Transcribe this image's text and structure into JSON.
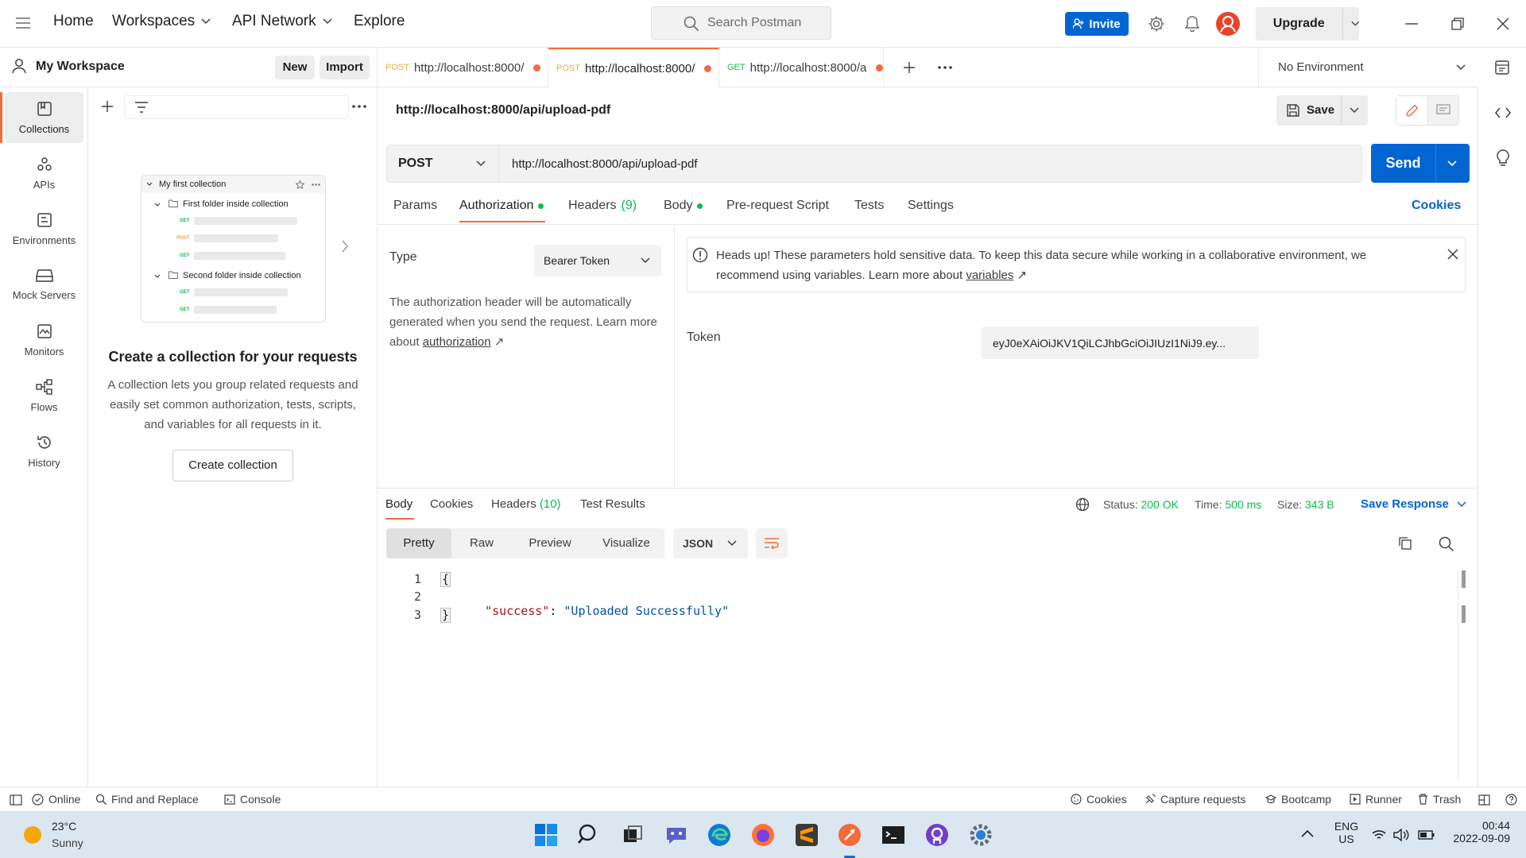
{
  "topbar": {
    "nav": [
      "Home",
      "Workspaces",
      "API Network",
      "Explore"
    ],
    "search_placeholder": "Search Postman",
    "invite_label": "Invite",
    "upgrade_label": "Upgrade"
  },
  "workspace": {
    "title": "My Workspace",
    "new_label": "New",
    "import_label": "Import"
  },
  "rail": {
    "items": [
      {
        "label": "Collections",
        "icon": "collections-icon"
      },
      {
        "label": "APIs",
        "icon": "apis-icon"
      },
      {
        "label": "Environments",
        "icon": "environments-icon"
      },
      {
        "label": "Mock Servers",
        "icon": "mock-servers-icon"
      },
      {
        "label": "Monitors",
        "icon": "monitors-icon"
      },
      {
        "label": "Flows",
        "icon": "flows-icon"
      },
      {
        "label": "History",
        "icon": "history-icon"
      }
    ]
  },
  "sidebar": {
    "preview": {
      "collection": "My first collection",
      "folder1": "First folder inside collection",
      "folder2": "Second folder inside collection",
      "methods": [
        "GET",
        "POST",
        "GET",
        "GET",
        "GET"
      ]
    },
    "empty_title": "Create a collection for your requests",
    "empty_desc": "A collection lets you group related requests and easily set common authorization, tests, scripts, and variables for all requests in it.",
    "create_label": "Create collection"
  },
  "tabs": [
    {
      "method": "POST",
      "url": "http://localhost:8000/"
    },
    {
      "method": "POST",
      "url": "http://localhost:8000/"
    },
    {
      "method": "GET",
      "url": "http://localhost:8000/a"
    }
  ],
  "environment": "No Environment",
  "request": {
    "title": "http://localhost:8000/api/upload-pdf",
    "save_label": "Save",
    "method": "POST",
    "url": "http://localhost:8000/api/upload-pdf",
    "send_label": "Send",
    "subtabs": {
      "params": "Params",
      "authorization": "Authorization",
      "headers": "Headers",
      "headers_count": "(9)",
      "body": "Body",
      "prerequest": "Pre-request Script",
      "tests": "Tests",
      "settings": "Settings",
      "cookies": "Cookies"
    }
  },
  "auth": {
    "type_label": "Type",
    "type_value": "Bearer Token",
    "desc": "The authorization header will be automatically generated when you send the request. Learn more about ",
    "desc_link": "authorization",
    "notice": "Heads up! These parameters hold sensitive data. To keep this data secure while working in a collaborative environment, we recommend using variables. Learn more about ",
    "notice_link": "variables",
    "token_label": "Token",
    "token_value": "eyJ0eXAiOiJKV1QiLCJhbGciOiJIUzI1NiJ9.ey..."
  },
  "response": {
    "tabs": {
      "body": "Body",
      "cookies": "Cookies",
      "headers": "Headers",
      "headers_count": "(10)",
      "tests": "Test Results"
    },
    "status_label": "Status:",
    "status_value": "200 OK",
    "time_label": "Time:",
    "time_value": "500 ms",
    "size_label": "Size:",
    "size_value": "343 B",
    "save_label": "Save Response",
    "views": [
      "Pretty",
      "Raw",
      "Preview",
      "Visualize"
    ],
    "format": "JSON",
    "code": {
      "line_numbers": [
        "1",
        "2",
        "3"
      ],
      "open": "{",
      "key": "\"success\"",
      "colon": ": ",
      "value": "\"Uploaded Successfully\"",
      "close": "}"
    }
  },
  "statusbar": {
    "online": "Online",
    "find": "Find and Replace",
    "console": "Console",
    "cookies": "Cookies",
    "capture": "Capture requests",
    "bootcamp": "Bootcamp",
    "runner": "Runner",
    "trash": "Trash"
  },
  "taskbar": {
    "weather_temp": "23°C",
    "weather_desc": "Sunny",
    "lang1": "ENG",
    "lang2": "US",
    "time": "00:44",
    "date": "2022-09-09"
  },
  "colors": {
    "accent": "#f26b3a",
    "primary": "#0265d2",
    "success": "#0cbb52"
  }
}
